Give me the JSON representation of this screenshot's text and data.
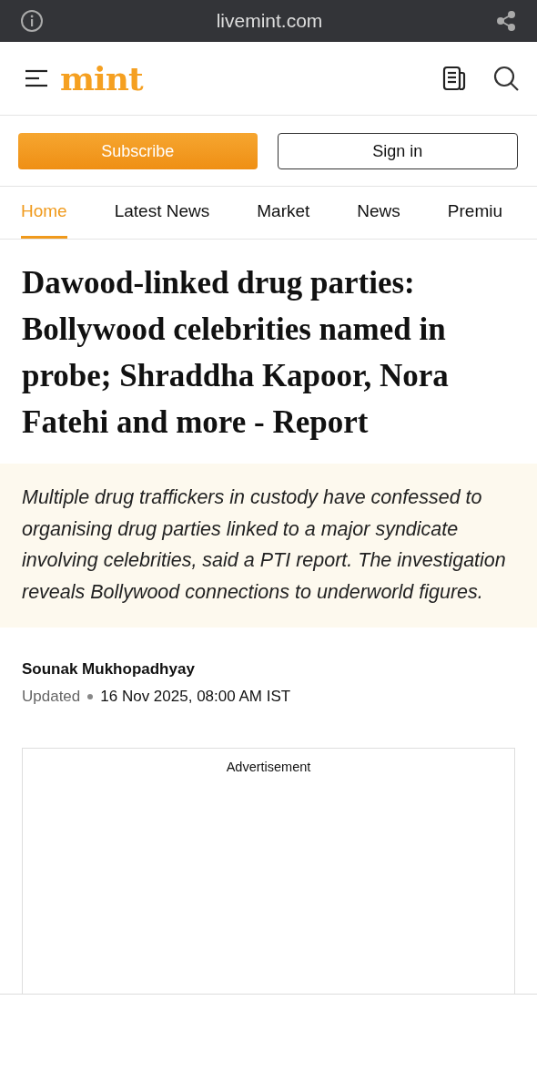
{
  "browser_bar": {
    "url": "livemint.com"
  },
  "header": {
    "logo": "mint"
  },
  "buttons": {
    "subscribe": "Subscribe",
    "sign_in": "Sign in"
  },
  "tabs": [
    {
      "label": "Home",
      "selected": true
    },
    {
      "label": "Latest News",
      "selected": false
    },
    {
      "label": "Market",
      "selected": false
    },
    {
      "label": "News",
      "selected": false
    },
    {
      "label": "Premiu",
      "selected": false
    }
  ],
  "article": {
    "headline": "Dawood-linked drug parties: Bollywood celebrities named in probe; Shraddha Kapoor, Nora Fatehi and more - Report",
    "summary": "Multiple drug traffickers in custody have confessed to organising drug parties linked to a major syndicate involving celebrities, said a PTI report. The investigation reveals Bollywood connections to underworld figures.",
    "author": "Sounak Mukhopadhyay",
    "updated_label": "Updated",
    "date": "16 Nov 2025, 08:00 AM IST"
  },
  "ad": {
    "label": "Advertisement"
  }
}
